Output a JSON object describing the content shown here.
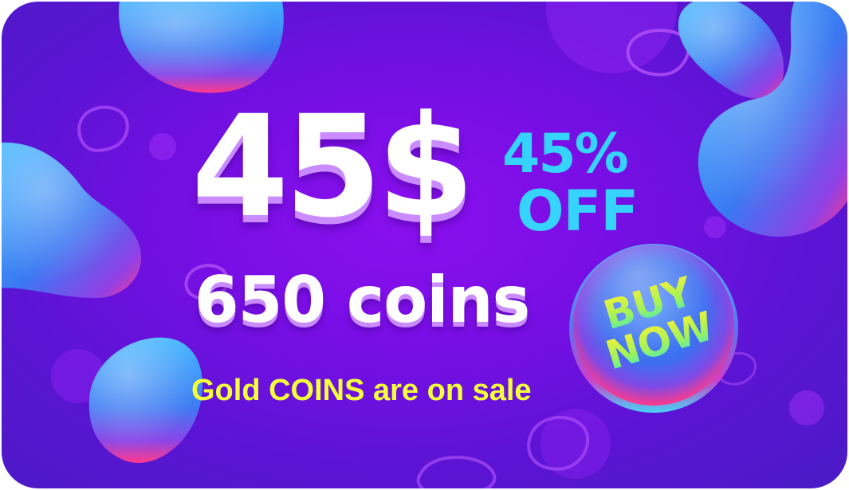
{
  "banner": {
    "price": "45$",
    "discount_percent": "45%",
    "discount_word": "OFF",
    "coins": "650 coins",
    "tagline": "Gold COINS are on sale"
  },
  "buy_button": {
    "line1": "BUY",
    "line2": "NOW"
  },
  "colors": {
    "background": "#7a0ee6",
    "price_text": "#ffffff",
    "price_shadow": "#c98bff",
    "discount_text": "#36d3ff",
    "tagline_text": "#f3ff3a",
    "blob_blue": "#3c8cf5",
    "blob_pink": "#ff3c8c",
    "button_text_top": "#f4f237",
    "button_text_bottom": "#41e9c8"
  }
}
